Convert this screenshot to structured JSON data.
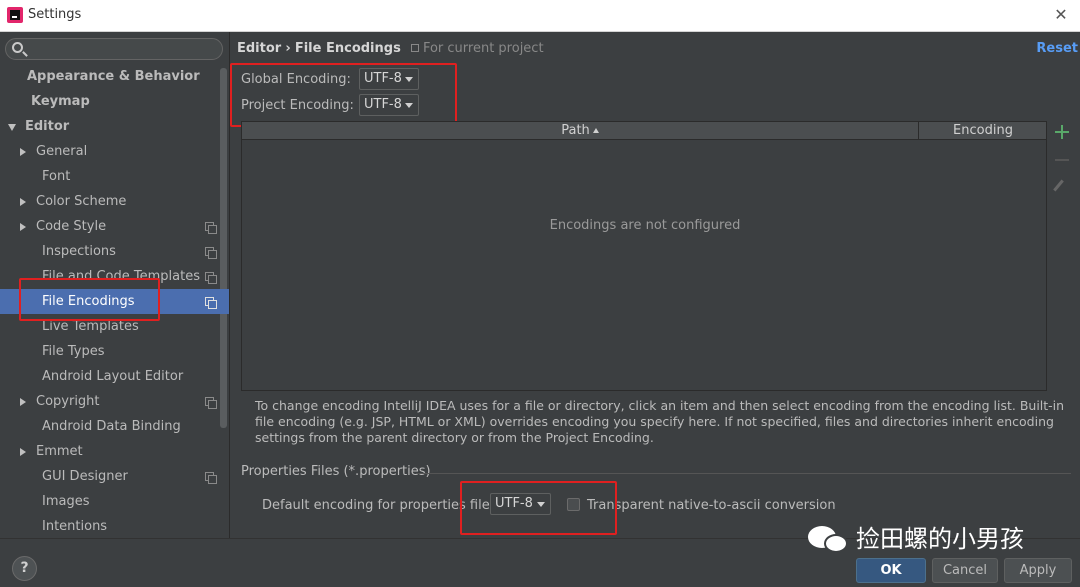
{
  "window": {
    "title": "Settings",
    "close_glyph": "✕"
  },
  "sidebar": {
    "search_placeholder": "",
    "items": [
      {
        "label": "Appearance & Behavior"
      },
      {
        "label": "Keymap"
      },
      {
        "label": "Editor"
      },
      {
        "label": "General"
      },
      {
        "label": "Font"
      },
      {
        "label": "Color Scheme"
      },
      {
        "label": "Code Style"
      },
      {
        "label": "Inspections"
      },
      {
        "label": "File and Code Templates"
      },
      {
        "label": "File Encodings"
      },
      {
        "label": "Live Templates"
      },
      {
        "label": "File Types"
      },
      {
        "label": "Android Layout Editor"
      },
      {
        "label": "Copyright"
      },
      {
        "label": "Android Data Binding"
      },
      {
        "label": "Emmet"
      },
      {
        "label": "GUI Designer"
      },
      {
        "label": "Images"
      },
      {
        "label": "Intentions"
      }
    ],
    "selected": "File Encodings"
  },
  "main": {
    "breadcrumb": {
      "parent": "Editor",
      "separator": "›",
      "current": "File Encodings",
      "scope": "For current project"
    },
    "reset_label": "Reset",
    "global_encoding": {
      "label": "Global Encoding:",
      "value": "UTF-8"
    },
    "project_encoding": {
      "label": "Project Encoding:",
      "value": "UTF-8"
    },
    "table": {
      "columns": [
        "Path",
        "Encoding"
      ],
      "sort_column": "Path",
      "empty_text": "Encodings are not configured"
    },
    "help_text": "To change encoding IntelliJ IDEA uses for a file or directory, click an item and then select encoding from the encoding list. Built-in file encoding (e.g. JSP, HTML or XML) overrides encoding you specify here. If not specified, files and directories inherit encoding settings from the parent directory or from the Project Encoding.",
    "properties": {
      "title": "Properties Files (*.properties)",
      "default_label": "Default encoding for properties files:",
      "default_value": "UTF-8",
      "native_ascii_label": "Transparent native-to-ascii conversion",
      "native_ascii_checked": false
    }
  },
  "footer": {
    "help": "?",
    "ok": "OK",
    "cancel": "Cancel",
    "apply": "Apply"
  },
  "watermark": {
    "text": "捡田螺的小男孩",
    "icon": "wechat-icon"
  },
  "colors": {
    "accent": "#4b6eaf",
    "link": "#589df6",
    "highlight": "#e02020",
    "background": "#3c3f41"
  }
}
